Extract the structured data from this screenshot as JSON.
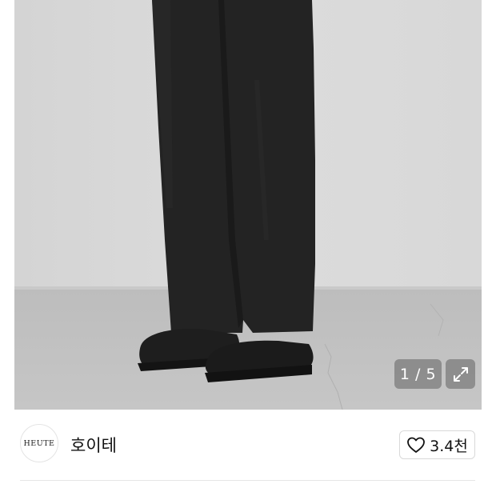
{
  "gallery": {
    "counter_text": "1 / 5",
    "current_index": 1,
    "total": 5
  },
  "brand": {
    "logo_text": "HEUTE",
    "name": "호이테"
  },
  "like": {
    "count_text": "3.4천"
  },
  "icons": {
    "expand": "expand-icon",
    "heart": "heart-outline-icon"
  }
}
